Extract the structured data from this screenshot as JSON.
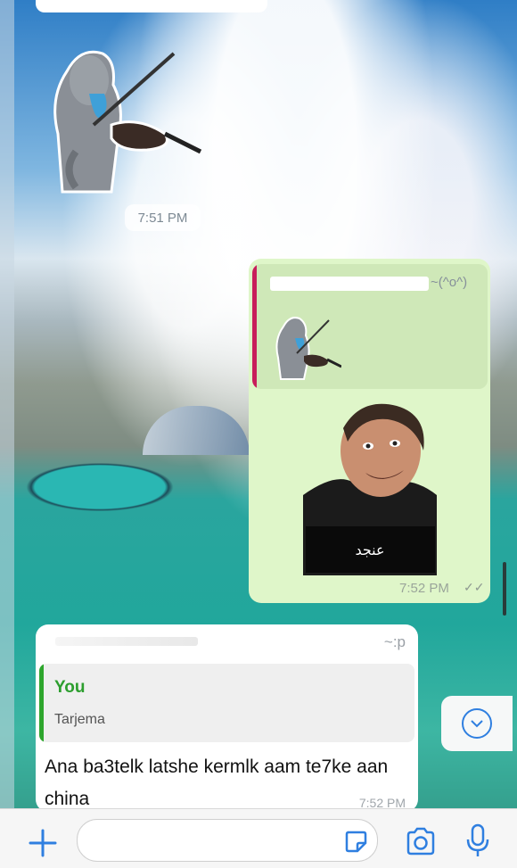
{
  "chat": {
    "date_time_chip": "7:51 PM",
    "outgoing": {
      "reply_suffix": "~(^o^)",
      "sticker_caption": "عنجد",
      "time": "7:52 PM",
      "status_icon": "double-check-icon"
    },
    "incoming": {
      "sender_suffix": "~:p",
      "quote_author": "You",
      "quote_text": "Tarjema",
      "message": "Ana ba3telk latshe kermlk aam te7ke aan china",
      "time": "7:52 PM"
    }
  },
  "composer": {
    "placeholder": "",
    "icons": [
      "plus-icon",
      "sticker-icon",
      "camera-icon",
      "microphone-icon"
    ]
  },
  "colors": {
    "outgoing_bubble": "#dff6c9",
    "incoming_bubble": "#ffffff",
    "reply_bar": "#c81d5b",
    "quote_bar": "#2ea62d",
    "accent_blue": "#2f7fe0"
  }
}
